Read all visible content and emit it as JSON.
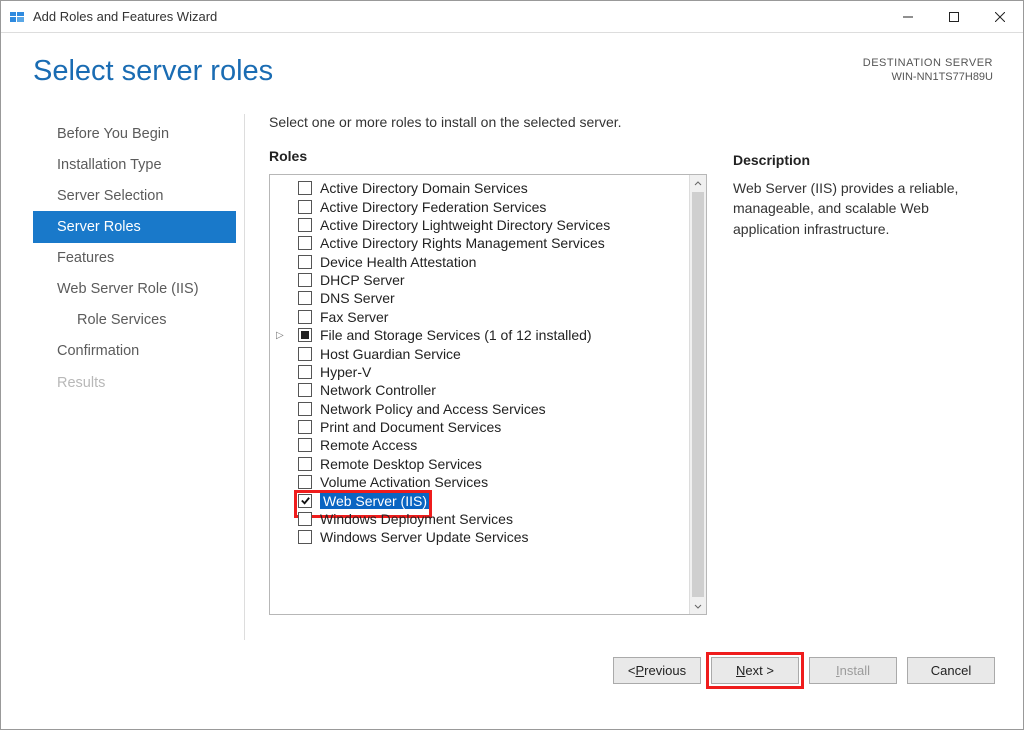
{
  "window": {
    "title": "Add Roles and Features Wizard"
  },
  "header": {
    "heading": "Select server roles",
    "dest_label": "DESTINATION SERVER",
    "dest_name": "WIN-NN1TS77H89U"
  },
  "nav": {
    "items": [
      {
        "label": "Before You Begin",
        "state": "normal"
      },
      {
        "label": "Installation Type",
        "state": "normal"
      },
      {
        "label": "Server Selection",
        "state": "normal"
      },
      {
        "label": "Server Roles",
        "state": "active"
      },
      {
        "label": "Features",
        "state": "normal"
      },
      {
        "label": "Web Server Role (IIS)",
        "state": "normal"
      },
      {
        "label": "Role Services",
        "state": "normal",
        "indent": true
      },
      {
        "label": "Confirmation",
        "state": "normal"
      },
      {
        "label": "Results",
        "state": "disabled"
      }
    ]
  },
  "content": {
    "instruction": "Select one or more roles to install on the selected server.",
    "roles_label": "Roles",
    "desc_label": "Description",
    "description": "Web Server (IIS) provides a reliable, manageable, and scalable Web application infrastructure.",
    "roles": [
      {
        "label": "Active Directory Domain Services",
        "check": "none"
      },
      {
        "label": "Active Directory Federation Services",
        "check": "none"
      },
      {
        "label": "Active Directory Lightweight Directory Services",
        "check": "none"
      },
      {
        "label": "Active Directory Rights Management Services",
        "check": "none"
      },
      {
        "label": "Device Health Attestation",
        "check": "none"
      },
      {
        "label": "DHCP Server",
        "check": "none"
      },
      {
        "label": "DNS Server",
        "check": "none"
      },
      {
        "label": "Fax Server",
        "check": "none"
      },
      {
        "label": "File and Storage Services (1 of 12 installed)",
        "check": "partial",
        "expandable": true
      },
      {
        "label": "Host Guardian Service",
        "check": "none"
      },
      {
        "label": "Hyper-V",
        "check": "none"
      },
      {
        "label": "Network Controller",
        "check": "none"
      },
      {
        "label": "Network Policy and Access Services",
        "check": "none"
      },
      {
        "label": "Print and Document Services",
        "check": "none"
      },
      {
        "label": "Remote Access",
        "check": "none"
      },
      {
        "label": "Remote Desktop Services",
        "check": "none"
      },
      {
        "label": "Volume Activation Services",
        "check": "none"
      },
      {
        "label": "Web Server (IIS)",
        "check": "checked",
        "selected": true,
        "highlight": true
      },
      {
        "label": "Windows Deployment Services",
        "check": "none"
      },
      {
        "label": "Windows Server Update Services",
        "check": "none"
      }
    ]
  },
  "footer": {
    "previous_pre": "< ",
    "previous_u": "P",
    "previous_post": "revious",
    "next_u": "N",
    "next_post": "ext >",
    "install_u": "I",
    "install_post": "nstall",
    "cancel": "Cancel"
  }
}
